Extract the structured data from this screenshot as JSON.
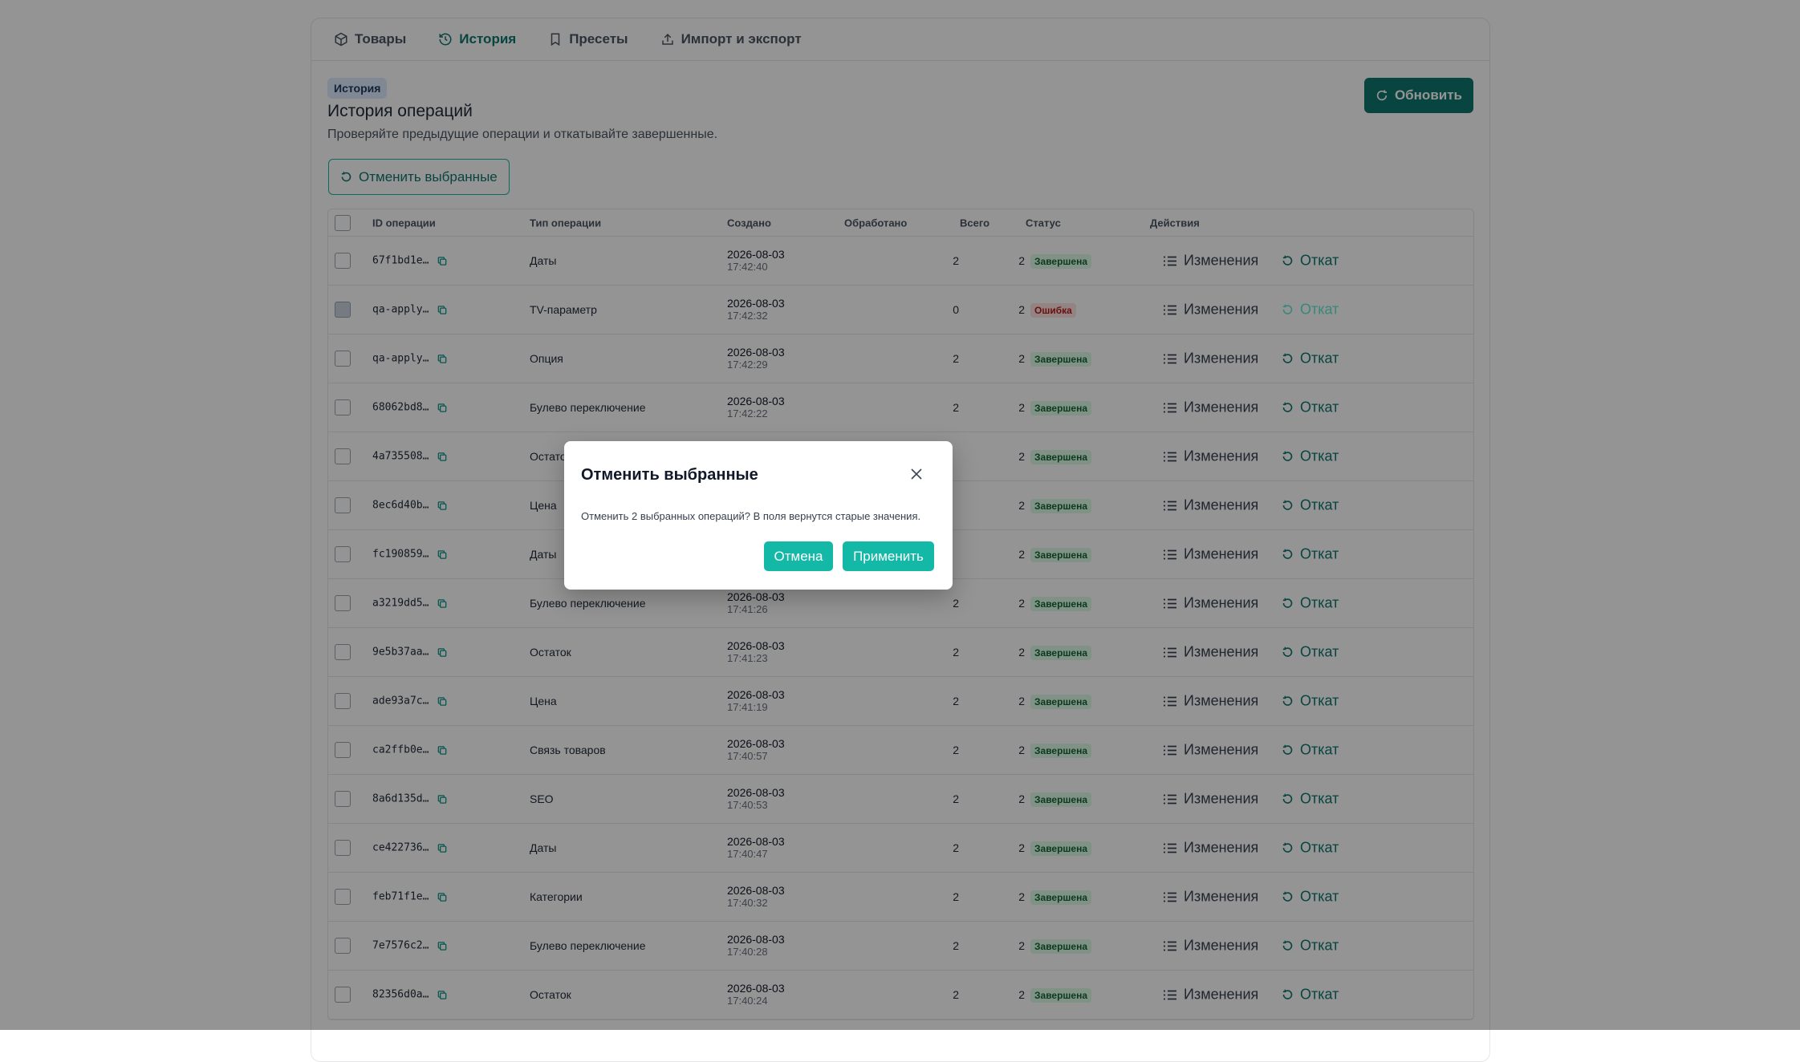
{
  "tabs": [
    {
      "label": "Товары",
      "icon": "box-icon"
    },
    {
      "label": "История",
      "icon": "history-icon"
    },
    {
      "label": "Пресеты",
      "icon": "bookmark-icon"
    },
    {
      "label": "Импорт и экспорт",
      "icon": "upload-icon"
    }
  ],
  "active_tab": 1,
  "section": {
    "badge": "История",
    "title": "История операций",
    "subtitle": "Проверяйте предыдущие операции и откатывайте завершенные.",
    "refresh_label": "Обновить",
    "undo_selected_label": "Отменить выбранные"
  },
  "table": {
    "headers": {
      "id": "ID операции",
      "type": "Тип операции",
      "created": "Создано",
      "processed": "Обработано",
      "total": "Всего",
      "status": "Статус",
      "actions": "Действия"
    },
    "changes_label": "Изменения",
    "rollback_label": "Откат",
    "rows": [
      {
        "id": "67f1bd1e…",
        "type": "Даты",
        "date": "2026-08-03",
        "time": "17:42:40",
        "processed": "2",
        "total": "2",
        "status": "Завершена",
        "ok": true,
        "checked": false
      },
      {
        "id": "qa-apply…",
        "type": "TV-параметр",
        "date": "2026-08-03",
        "time": "17:42:32",
        "processed": "0",
        "total": "2",
        "status": "Ошибка",
        "ok": false,
        "checked": true
      },
      {
        "id": "qa-apply…",
        "type": "Опция",
        "date": "2026-08-03",
        "time": "17:42:29",
        "processed": "2",
        "total": "2",
        "status": "Завершена",
        "ok": true,
        "checked": false
      },
      {
        "id": "68062bd8…",
        "type": "Булево переключение",
        "date": "2026-08-03",
        "time": "17:42:22",
        "processed": "2",
        "total": "2",
        "status": "Завершена",
        "ok": true,
        "checked": false
      },
      {
        "id": "4a735508…",
        "type": "Остаток",
        "date": "",
        "time": "",
        "processed": "",
        "total": "2",
        "status": "Завершена",
        "ok": true,
        "checked": false
      },
      {
        "id": "8ec6d40b…",
        "type": "Цена",
        "date": "",
        "time": "",
        "processed": "",
        "total": "2",
        "status": "Завершена",
        "ok": true,
        "checked": false
      },
      {
        "id": "fc190859…",
        "type": "Даты",
        "date": "",
        "time": "",
        "processed": "",
        "total": "2",
        "status": "Завершена",
        "ok": true,
        "checked": false
      },
      {
        "id": "a3219dd5…",
        "type": "Булево переключение",
        "date": "2026-08-03",
        "time": "17:41:26",
        "processed": "2",
        "total": "2",
        "status": "Завершена",
        "ok": true,
        "checked": false
      },
      {
        "id": "9e5b37aa…",
        "type": "Остаток",
        "date": "2026-08-03",
        "time": "17:41:23",
        "processed": "2",
        "total": "2",
        "status": "Завершена",
        "ok": true,
        "checked": false
      },
      {
        "id": "ade93a7c…",
        "type": "Цена",
        "date": "2026-08-03",
        "time": "17:41:19",
        "processed": "2",
        "total": "2",
        "status": "Завершена",
        "ok": true,
        "checked": false
      },
      {
        "id": "ca2ffb0e…",
        "type": "Связь товаров",
        "date": "2026-08-03",
        "time": "17:40:57",
        "processed": "2",
        "total": "2",
        "status": "Завершена",
        "ok": true,
        "checked": false
      },
      {
        "id": "8a6d135d…",
        "type": "SEO",
        "date": "2026-08-03",
        "time": "17:40:53",
        "processed": "2",
        "total": "2",
        "status": "Завершена",
        "ok": true,
        "checked": false
      },
      {
        "id": "ce422736…",
        "type": "Даты",
        "date": "2026-08-03",
        "time": "17:40:47",
        "processed": "2",
        "total": "2",
        "status": "Завершена",
        "ok": true,
        "checked": false
      },
      {
        "id": "feb71f1e…",
        "type": "Категории",
        "date": "2026-08-03",
        "time": "17:40:32",
        "processed": "2",
        "total": "2",
        "status": "Завершена",
        "ok": true,
        "checked": false
      },
      {
        "id": "7e7576c2…",
        "type": "Булево переключение",
        "date": "2026-08-03",
        "time": "17:40:28",
        "processed": "2",
        "total": "2",
        "status": "Завершена",
        "ok": true,
        "checked": false
      },
      {
        "id": "82356d0a…",
        "type": "Остаток",
        "date": "2026-08-03",
        "time": "17:40:24",
        "processed": "2",
        "total": "2",
        "status": "Завершена",
        "ok": true,
        "checked": false
      }
    ]
  },
  "modal": {
    "title": "Отменить выбранные",
    "text": "Отменить 2 выбранных операций? В поля вернутся старые значения.",
    "cancel_label": "Отмена",
    "apply_label": "Применить"
  }
}
